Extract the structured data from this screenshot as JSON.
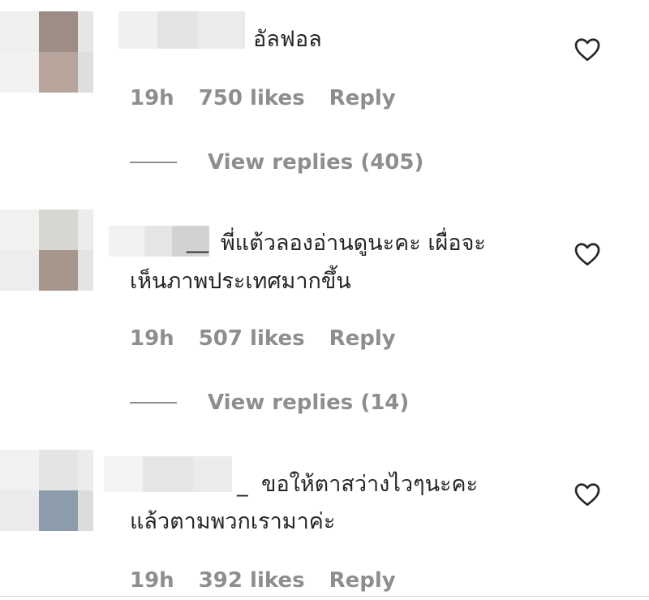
{
  "comments": [
    {
      "text": "อัลฟอล",
      "time": "19h",
      "likes": "750 likes",
      "reply_label": "Reply",
      "view_replies": "View replies (405)"
    },
    {
      "username_suffix": "__",
      "text_line1": "พี่แต้วลองอ่านดูนะคะ เผื่อจะ",
      "text_line2": "เห็นภาพประเทศมากขึ้น",
      "time": "19h",
      "likes": "507 likes",
      "reply_label": "Reply",
      "view_replies": "View replies (14)"
    },
    {
      "username_suffix": "_",
      "text_line1": "ขอให้ตาสว่างไวๆนะคะ",
      "text_line2": "แล้วตามพวกเรามาค่ะ",
      "time": "19h",
      "likes": "392 likes",
      "reply_label": "Reply"
    }
  ],
  "icons": {
    "like": "heart-outline-icon"
  },
  "colors": {
    "text": "#262626",
    "secondary": "#8e8e8e"
  }
}
